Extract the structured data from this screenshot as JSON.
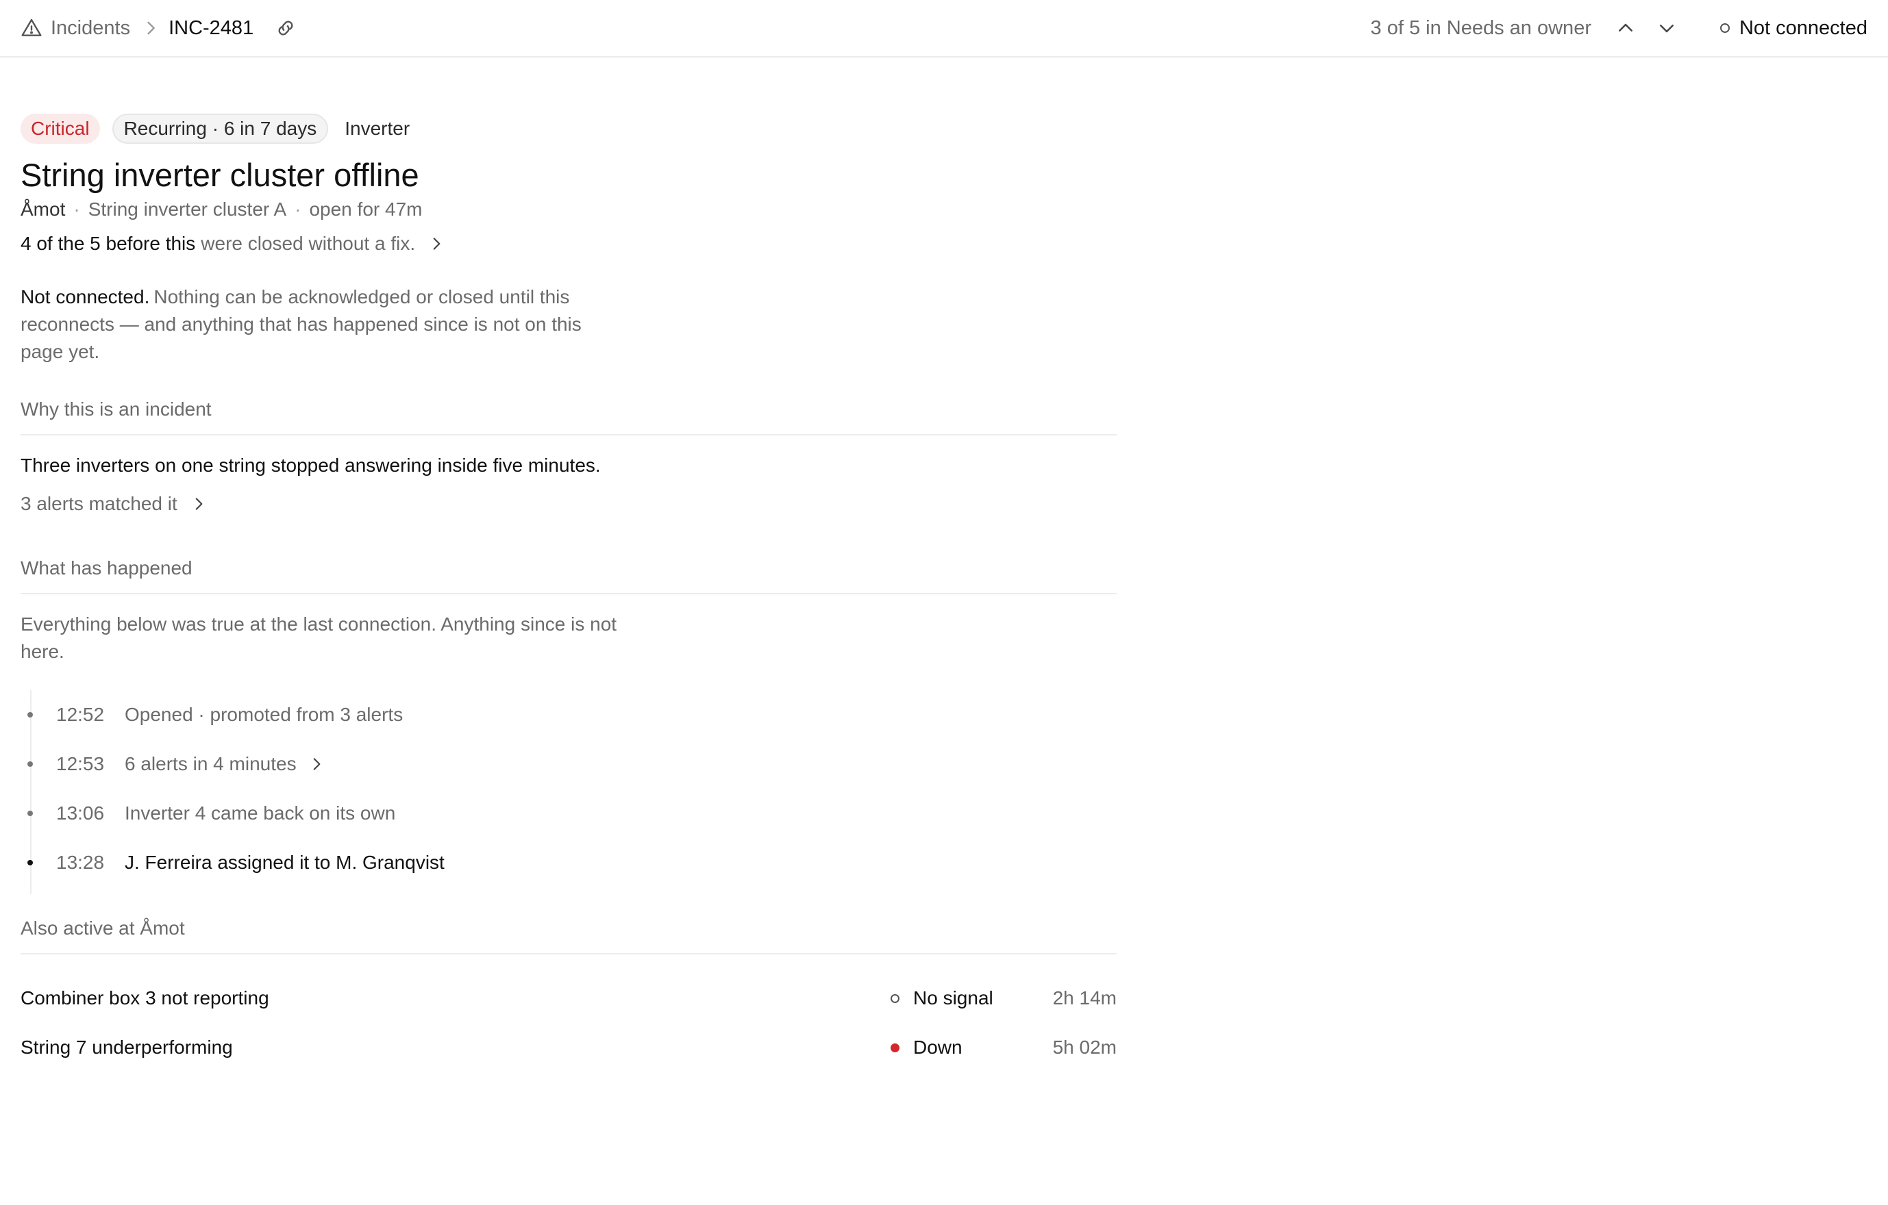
{
  "breadcrumb": {
    "parent": "Incidents",
    "current": "INC-2481"
  },
  "navigation": {
    "position": "3 of 5 in Needs an owner"
  },
  "connection": {
    "label": "Not connected"
  },
  "incident": {
    "severity": "Critical",
    "recurring": "Recurring · 6 in 7 days",
    "category": "Inverter",
    "title": "String inverter cluster offline",
    "site": "Åmot",
    "asset": "String inverter cluster A",
    "open_for": "open for 47m",
    "recurrence_lead": "4 of the 5 before this",
    "recurrence_tail": "were closed without a fix."
  },
  "notice": {
    "lead": "Not connected.",
    "body": "Nothing can be acknowledged or closed until this reconnects — and anything that has happened since is not on this page yet."
  },
  "why": {
    "heading": "Why this is an incident",
    "reason": "Three inverters on one string stopped answering inside five minutes.",
    "matched": "3 alerts matched it"
  },
  "history": {
    "heading": "What has happened",
    "caveat": "Everything below was true at the last connection. Anything since is not here.",
    "events": [
      {
        "time": "12:52",
        "text": "Opened · promoted from 3 alerts"
      },
      {
        "time": "12:53",
        "text": "6 alerts in 4 minutes"
      },
      {
        "time": "13:06",
        "text": "Inverter 4 came back on its own"
      },
      {
        "time": "13:28",
        "text": "J. Ferreira assigned it to M. Granqvist"
      }
    ]
  },
  "also_active": {
    "heading": "Also active at Åmot",
    "rows": [
      {
        "name": "Combiner box 3 not reporting",
        "status": "No signal",
        "duration": "2h 14m"
      },
      {
        "name": "String 7 underperforming",
        "status": "Down",
        "duration": "5h 02m"
      }
    ]
  },
  "colors": {
    "critical": "#c8262a",
    "down": "#d4262b",
    "muted_text": "#6b6b6b",
    "divider": "#ececec"
  },
  "icons": [
    "warning-triangle-icon",
    "chevron-right-icon",
    "link-icon",
    "chevron-up-icon",
    "chevron-down-icon",
    "status-ring-icon",
    "status-dot-icon"
  ]
}
